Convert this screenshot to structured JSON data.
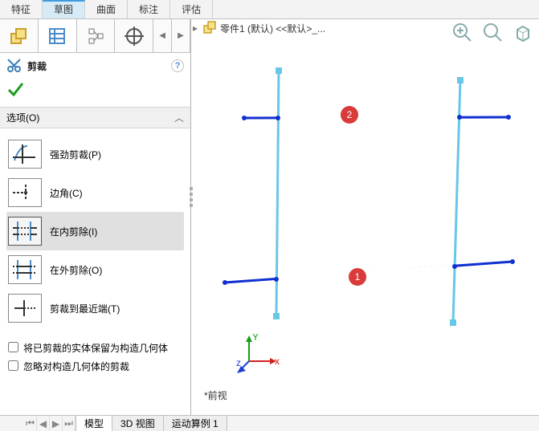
{
  "top_tabs": {
    "t0": "特征",
    "t1": "草图",
    "t2": "曲面",
    "t3": "标注",
    "t4": "评估"
  },
  "active_top_tab": "t1",
  "breadcrumb": {
    "text": "零件1 (默认) <<默认>_..."
  },
  "property_manager": {
    "title": "剪裁",
    "help_symbol": "?",
    "section_label": "选项(O)",
    "options": {
      "o0": "强劲剪裁(P)",
      "o1": "边角(C)",
      "o2": "在内剪除(I)",
      "o3": "在外剪除(O)",
      "o4": "剪裁到最近端(T)"
    },
    "checkboxes": {
      "c0": "将已剪裁的实体保留为构造几何体",
      "c1": "忽略对构造几何体的剪裁"
    }
  },
  "markers": {
    "m1": "1",
    "m2": "2"
  },
  "triad": {
    "x": "x",
    "y": "Y",
    "z": "z"
  },
  "view_label": "*前视",
  "bottom_tabs": {
    "b0": "模型",
    "b1": "3D 视图",
    "b2": "运动算例 1"
  }
}
